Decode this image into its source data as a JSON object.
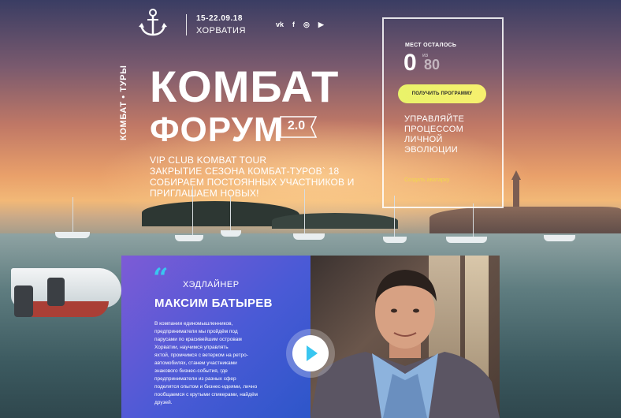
{
  "header": {
    "dates": "15-22.09.18",
    "place": "ХОРВАТИЯ",
    "social": [
      {
        "name": "vk-icon",
        "label": "vk"
      },
      {
        "name": "facebook-icon",
        "label": "f"
      },
      {
        "name": "instagram-icon",
        "label": "◎"
      },
      {
        "name": "youtube-icon",
        "label": "▶"
      }
    ]
  },
  "brand": {
    "vertical": "КОМБАТ • ТУРЫ",
    "title_line1": "КОМБАТ",
    "title_line2": "ФОРУМ",
    "version": "2.0"
  },
  "intro": {
    "line1": "VIP CLUB KOMBAT TOUR",
    "line2": "ЗАКРЫТИЕ СЕЗОНА КОМБАТ-ТУРОВ` 18",
    "line3": "СОБИРАЕМ ПОСТОЯННЫХ УЧАСТНИКОВ И",
    "line4": "ПРИГЛАШАЕМ НОВЫХ!"
  },
  "panel": {
    "seats_label": "МЕСТ ОСТАЛОСЬ",
    "seats_left": "0",
    "seats_slash": "из",
    "seats_total": "80",
    "cta_label": "ПОЛУЧИТЬ ПРОГРАММУ",
    "slogan_line1": "УПРАВЛЯЙТЕ",
    "slogan_line2": "ПРОЦЕССОМ",
    "slogan_line3": "ЛИЧНОЙ",
    "slogan_line4": "ЭВОЛЮЦИИ",
    "avatar_link": "Создать аватарку"
  },
  "speaker": {
    "quote_mark": "“",
    "role": "ХЭДЛАЙНЕР",
    "name": "МАКСИМ БАТЫРЕВ",
    "bio": [
      "В компании единомышленников,",
      "предприниматели мы пройдём под",
      "парусами по красивейшим островам",
      "Хорватии, научимся управлять",
      "яхтой, промчимся с ветерком на ретро-",
      "автомобилях, станем участниками",
      "знакового бизнес-события, где",
      "предприниматели из разных сфер",
      "поделятся опытом и бизнес-идеями, лично",
      "пообщаемся с крутыми спикерами, найдём",
      "друзей."
    ]
  },
  "colors": {
    "accent_blue": "#39c6f0",
    "cta_yellow": "#eef26a",
    "speaker_gradient_start": "#7d5bd6",
    "speaker_gradient_end": "#2d56c9",
    "link_yellow": "#f1d84d"
  }
}
